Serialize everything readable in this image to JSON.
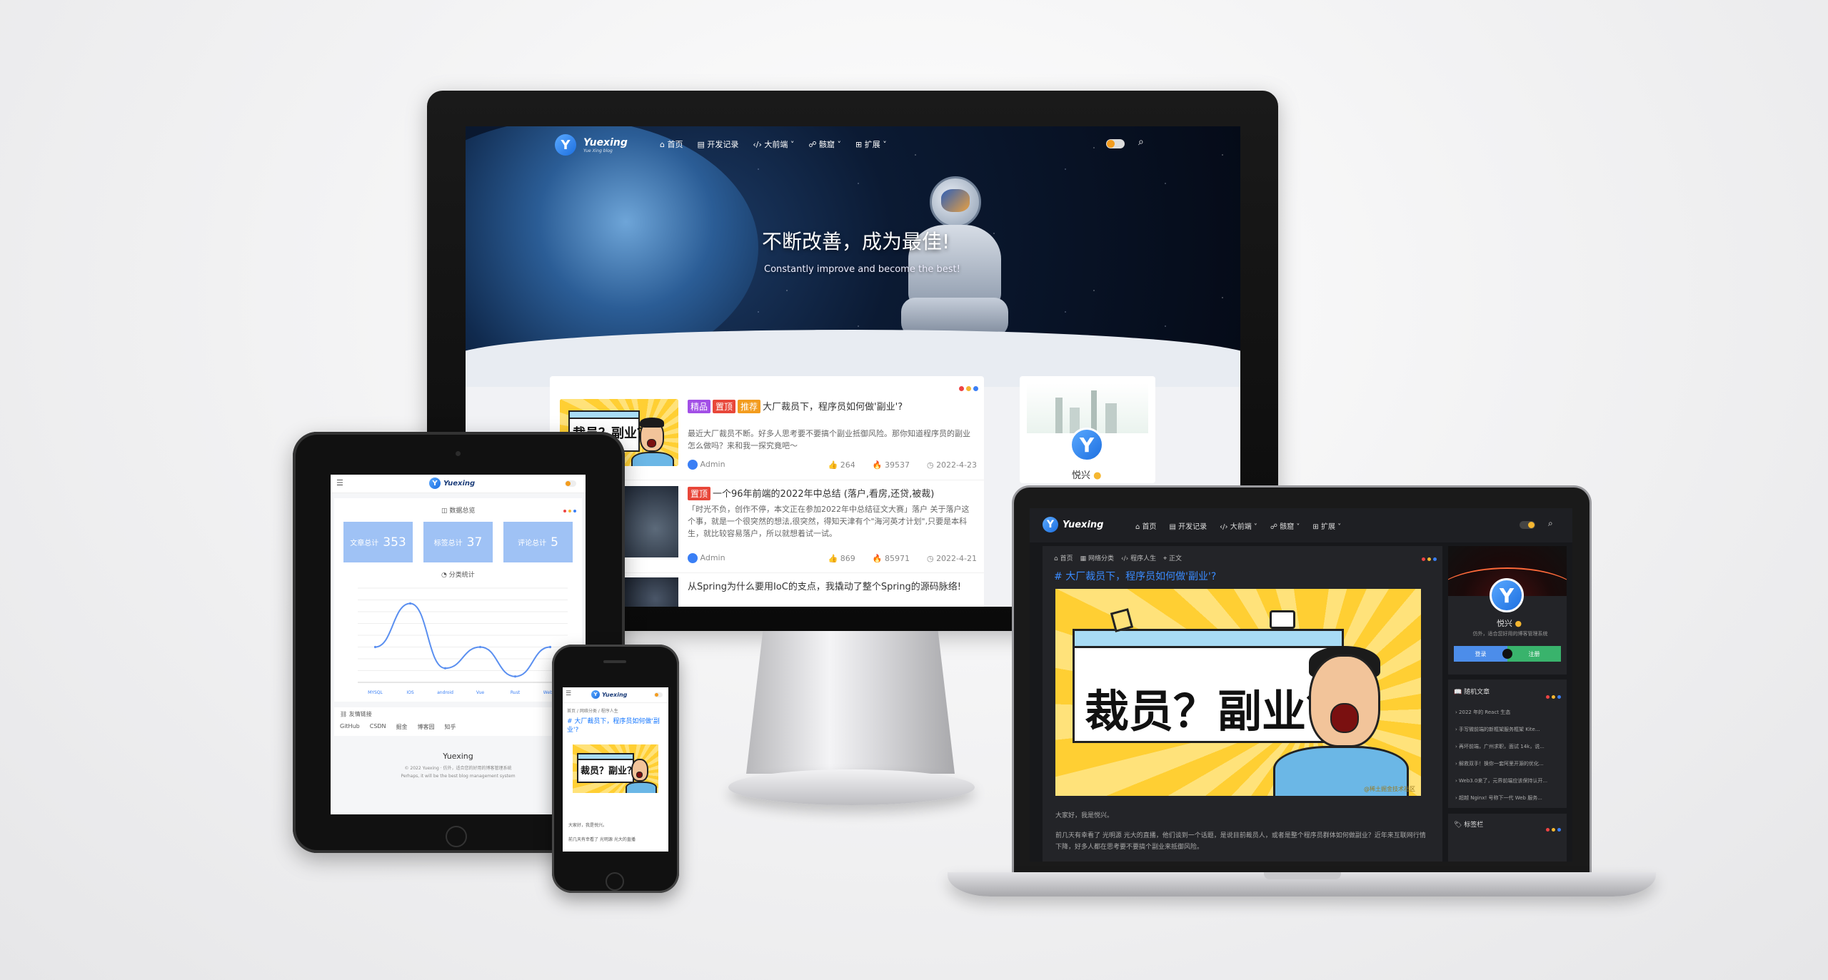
{
  "brand": {
    "name": "Yuexing",
    "tagline": "Yue Xing blog"
  },
  "monitor": {
    "nav": [
      {
        "label": "首页",
        "icon": "home-icon"
      },
      {
        "label": "开发记录",
        "icon": "doc-icon"
      },
      {
        "label": "大前端",
        "icon": "code-icon"
      },
      {
        "label": "骸窟",
        "icon": "users-icon"
      },
      {
        "label": "扩展",
        "icon": "grid-icon"
      }
    ],
    "hero_title": "不断改善，成为最佳!",
    "hero_subtitle": "Constantly improve and become the best!",
    "posts": [
      {
        "tags": [
          "精品",
          "置顶",
          "推荐"
        ],
        "title": "大厂裁员下，程序员如何做'副业'?",
        "excerpt": "最近大厂裁员不断。好多人思考要不要搞个副业抵御风险。那你知道程序员的副业怎么做吗？来和我一探究竟吧～",
        "author": "Admin",
        "likes": "264",
        "views": "39537",
        "date": "2022-4-23"
      },
      {
        "tags": [
          "置顶"
        ],
        "title": "一个96年前端的2022年中总结 (落户,看房,还贷,被裁)",
        "excerpt": "「时光不负，创作不停，本文正在参加2022年中总结征文大赛」落户 关于落户这个事，就是一个很突然的想法,很突然，得知天津有个\"海河英才计划\",只要是本科生，就比较容易落户，所以就想着试一试。",
        "author": "Admin",
        "likes": "869",
        "views": "85971",
        "date": "2022-4-21"
      },
      {
        "tags": [],
        "title": "从Spring为什么要用IoC的支点，我撬动了整个Spring的源码脉络!"
      }
    ],
    "profile": {
      "name": "悦兴"
    }
  },
  "tablet": {
    "section_title": "数据总览",
    "stats": [
      {
        "label": "文章总计",
        "value": "353"
      },
      {
        "label": "标签总计",
        "value": "37"
      },
      {
        "label": "评论总计",
        "value": "5"
      }
    ],
    "chart_title": "分类统计",
    "links_title": "友情链接",
    "links": [
      "GitHub",
      "CSDN",
      "掘金",
      "博客园",
      "知乎"
    ],
    "footer_name": "Yuexing",
    "footer_copy": "© 2022 Yuexing · 仿外，适合您的好用的博客管理系统",
    "footer_slogan": "Perhaps, it will be the best blog management system"
  },
  "phone": {
    "breadcrumb": [
      "首页",
      "网络分类",
      "程序人生"
    ],
    "title": "大厂裁员下，程序员如何做'副业'?",
    "cover_text": "裁员？副业？",
    "body1": "大家好，我是悦兴。",
    "body2": "前几天有幸看了 光明源 光大的直播"
  },
  "laptop": {
    "nav": [
      {
        "label": "首页"
      },
      {
        "label": "开发记录"
      },
      {
        "label": "大前端"
      },
      {
        "label": "骸窟"
      },
      {
        "label": "扩展"
      }
    ],
    "breadcrumb": [
      "首页",
      "网络分类",
      "程序人生",
      "正文"
    ],
    "article_title": "大厂裁员下，程序员如何做'副业'?",
    "cover_text": "裁员？副业？",
    "watermark": "@稀土掘金技术社区",
    "para1": "大家好，我是悦兴。",
    "para2": "前几天有幸看了 光明源 光大的直播，他们谈到一个话题，是说目前裁员人，或者是整个程序员群体如何做副业？近年来互联网行情下降，好多人都在思考要不要搞个副业来抵御风险。",
    "profile_name": "悦兴",
    "profile_bio": "仿外，适合您好用的博客管理系统",
    "login_label": "登录",
    "register_label": "注册",
    "random_title": "随机文章",
    "random_posts": [
      "2022 年的 React 生态",
      "手写微前端的新框架服务框架 Kite...",
      "再坏前端，广州求职，面试 14k，说...",
      "解救双手！换你一套阿里开源的优化...",
      "Web3.0来了，元界前端应该保持认开...",
      "超越 Nginx! 号称下一代 Web 服务..."
    ],
    "tags_title": "标签栏"
  },
  "colors": {
    "accent": "#1677ff",
    "tag_purple": "#a24fe6",
    "tag_red": "#e8473a",
    "tag_orange": "#f39c1e",
    "dot_red": "#ee4444",
    "dot_yellow": "#f5b731",
    "dot_blue": "#3a7ff5",
    "stat_card": "#9fc2f5",
    "login_btn": "#4c8dea",
    "register_btn": "#39b36c"
  },
  "chart_data": {
    "type": "line",
    "title": "分类统计",
    "categories": [
      "MYSQL",
      "IOS",
      "android",
      "Vue",
      "Rust",
      "WebGl"
    ],
    "values": [
      30,
      67,
      12,
      30,
      5,
      30
    ],
    "ylim": [
      0,
      80
    ],
    "grid": true
  }
}
